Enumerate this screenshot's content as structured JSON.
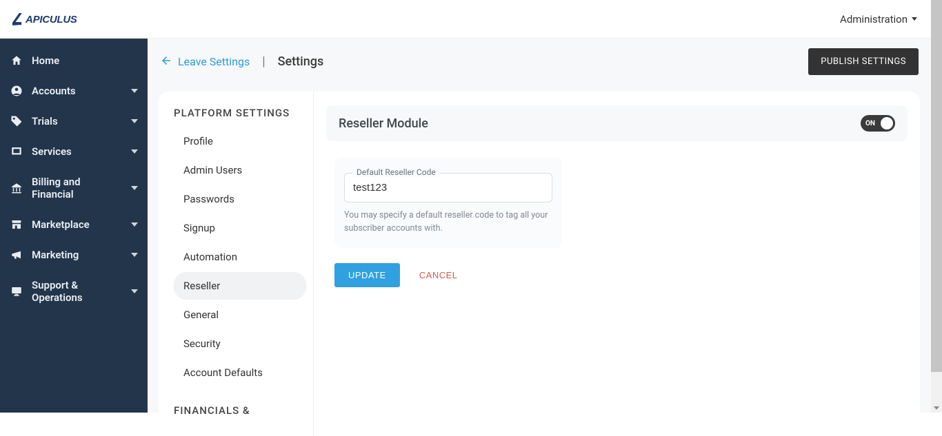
{
  "brand": "APICULUS",
  "topbar": {
    "admin_label": "Administration"
  },
  "sidebar": {
    "items": [
      {
        "key": "home",
        "label": "Home",
        "expandable": false
      },
      {
        "key": "accounts",
        "label": "Accounts",
        "expandable": true
      },
      {
        "key": "trials",
        "label": "Trials",
        "expandable": true
      },
      {
        "key": "services",
        "label": "Services",
        "expandable": true
      },
      {
        "key": "billing",
        "label": "Billing and Financial",
        "expandable": true
      },
      {
        "key": "marketplace",
        "label": "Marketplace",
        "expandable": true
      },
      {
        "key": "marketing",
        "label": "Marketing",
        "expandable": true
      },
      {
        "key": "support",
        "label": "Support & Operations",
        "expandable": true
      }
    ]
  },
  "header": {
    "leave_label": "Leave Settings",
    "page_title": "Settings",
    "publish_label": "PUBLISH SETTINGS"
  },
  "subnav": {
    "group1_heading": "PLATFORM SETTINGS",
    "group1_items": [
      "Profile",
      "Admin Users",
      "Passwords",
      "Signup",
      "Automation",
      "Reseller",
      "General",
      "Security",
      "Account Defaults"
    ],
    "active_index": 5,
    "group2_heading": "FINANCIALS &"
  },
  "panel": {
    "title": "Reseller Module",
    "toggle_state": "ON",
    "field_label": "Default Reseller Code",
    "field_value": "test123",
    "field_help": "You may specify a default reseller code to tag all your subscriber accounts with.",
    "update_label": "UPDATE",
    "cancel_label": "CANCEL"
  }
}
